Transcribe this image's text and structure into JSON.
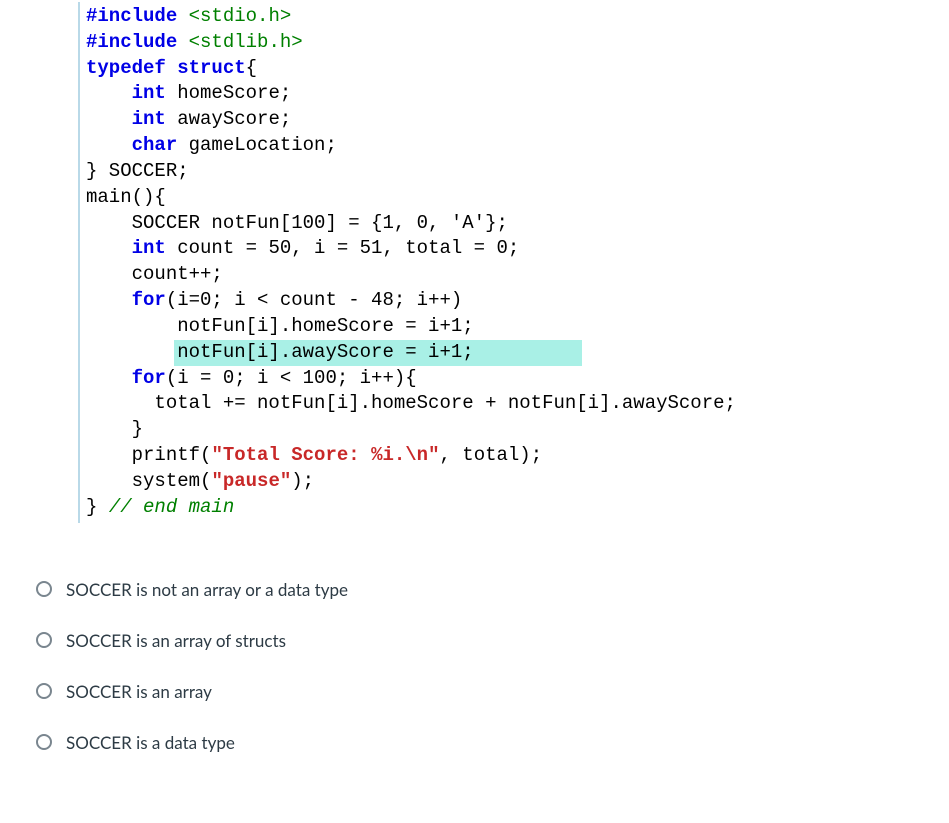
{
  "code": {
    "lines": [
      {
        "indent": 0,
        "segments": [
          {
            "cls": "kw",
            "t": "#include "
          },
          {
            "cls": "hdr",
            "t": "<stdio.h>"
          }
        ]
      },
      {
        "indent": 0,
        "segments": [
          {
            "cls": "kw",
            "t": "#include "
          },
          {
            "cls": "hdr",
            "t": "<stdlib.h>"
          }
        ]
      },
      {
        "indent": 0,
        "segments": [
          {
            "cls": "kw",
            "t": "typedef struct"
          },
          {
            "cls": "plain",
            "t": "{"
          }
        ]
      },
      {
        "indent": 1,
        "segments": [
          {
            "cls": "kw",
            "t": "int"
          },
          {
            "cls": "plain",
            "t": " homeScore;"
          }
        ]
      },
      {
        "indent": 1,
        "segments": [
          {
            "cls": "kw",
            "t": "int"
          },
          {
            "cls": "plain",
            "t": " awayScore;"
          }
        ]
      },
      {
        "indent": 1,
        "segments": [
          {
            "cls": "kw",
            "t": "char"
          },
          {
            "cls": "plain",
            "t": " gameLocation;"
          }
        ]
      },
      {
        "indent": 0,
        "segments": [
          {
            "cls": "plain",
            "t": "} SOCCER;"
          }
        ]
      },
      {
        "indent": 0,
        "segments": [
          {
            "cls": "plain",
            "t": "main(){"
          }
        ]
      },
      {
        "indent": 1,
        "segments": [
          {
            "cls": "plain",
            "t": "SOCCER notFun[100] = {1, 0, 'A'};"
          }
        ]
      },
      {
        "indent": 1,
        "segments": [
          {
            "cls": "kw",
            "t": "int"
          },
          {
            "cls": "plain",
            "t": " count = 50, i = 51, total = 0;"
          }
        ]
      },
      {
        "indent": 1,
        "segments": [
          {
            "cls": "plain",
            "t": "count++;"
          }
        ]
      },
      {
        "indent": 1,
        "segments": [
          {
            "cls": "kw",
            "t": "for"
          },
          {
            "cls": "plain",
            "t": "(i=0; i < count - 48; i++)"
          }
        ]
      },
      {
        "indent": 2,
        "segments": [
          {
            "cls": "plain",
            "t": "notFun[i].homeScore = i+1;"
          }
        ]
      },
      {
        "indent": 2,
        "highlight": true,
        "segments": [
          {
            "cls": "plain",
            "t": "notFun[i].awayScore = i+1;"
          }
        ]
      },
      {
        "indent": 1,
        "segments": [
          {
            "cls": "kw",
            "t": "for"
          },
          {
            "cls": "plain",
            "t": "(i = 0; i < 100; i++){"
          }
        ]
      },
      {
        "indent": 1,
        "segments": [
          {
            "cls": "plain",
            "t": "  total += notFun[i].homeScore + notFun[i].awayScore;"
          }
        ]
      },
      {
        "indent": 1,
        "segments": [
          {
            "cls": "plain",
            "t": "}"
          }
        ]
      },
      {
        "indent": 1,
        "segments": [
          {
            "cls": "plain",
            "t": "printf("
          },
          {
            "cls": "str",
            "t": "\"Total Score: %i.\\n\""
          },
          {
            "cls": "plain",
            "t": ", total);"
          }
        ]
      },
      {
        "indent": 1,
        "segments": [
          {
            "cls": "plain",
            "t": "system("
          },
          {
            "cls": "str",
            "t": "\"pause\""
          },
          {
            "cls": "plain",
            "t": ");"
          }
        ]
      },
      {
        "indent": 0,
        "segments": [
          {
            "cls": "plain",
            "t": "} "
          },
          {
            "cls": "comment",
            "t": "// end main"
          }
        ]
      }
    ]
  },
  "answers": [
    {
      "label": "SOCCER is not an array or a data type"
    },
    {
      "label": "SOCCER is an array of structs"
    },
    {
      "label": "SOCCER is an array"
    },
    {
      "label": "SOCCER is a data type"
    }
  ]
}
